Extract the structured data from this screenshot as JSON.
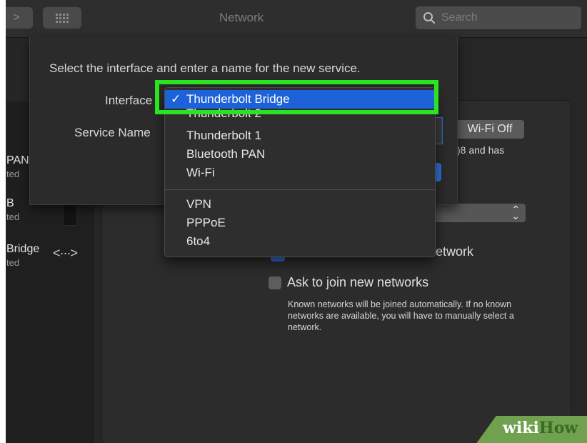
{
  "toolbar": {
    "forward_glyph": ">",
    "window_title": "Network",
    "search_placeholder": "Search"
  },
  "sidebar": {
    "items": [
      {
        "name": "PAN",
        "status": "ted"
      },
      {
        "name": "B",
        "status": "ted"
      },
      {
        "name": "Bridge",
        "status": "ted"
      }
    ],
    "bridge_icon_glyph": "<···>"
  },
  "sheet": {
    "prompt": "Select the interface and enter a name for the new service.",
    "interface_label": "Interface",
    "service_name_label": "Service Name"
  },
  "menu": {
    "check_glyph": "✓",
    "selected": "Thunderbolt Bridge",
    "items": [
      "Thunderbolt Bridge",
      "Thunderbolt 2",
      "Thunderbolt 1",
      "Bluetooth PAN",
      "Wi-Fi",
      "VPN",
      "PPPoE",
      "6to4"
    ]
  },
  "main": {
    "wifi_off_label": "Wi-Fi Off",
    "status_partial": ")8 and has",
    "network_text": "network",
    "ask_join_label": "Ask to join new networks",
    "help_text": "Known networks will be joined automatically. If no known networks are available, you will have to manually select a network."
  },
  "watermark": {
    "wiki": "wiki",
    "how": "How"
  },
  "colors": {
    "highlight": "#29e51f",
    "selection_blue": "#1d62d8",
    "window_bg": "#262626"
  }
}
